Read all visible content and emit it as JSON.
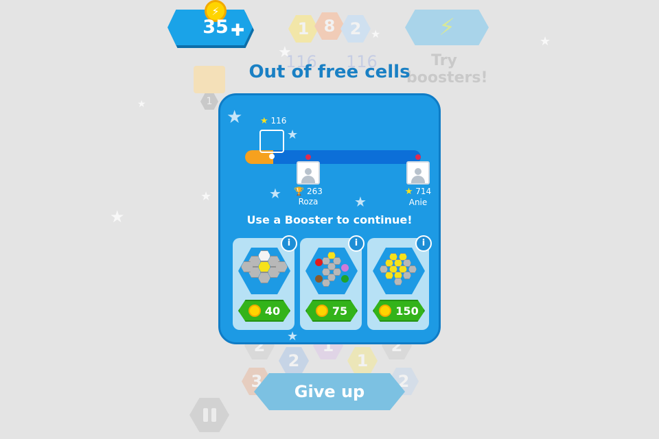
{
  "header": {
    "coin_balance": "35",
    "add_coins_icon": "plus-icon"
  },
  "background": {
    "top_hexes": [
      "1",
      "8",
      "2"
    ],
    "scores_left": "116",
    "scores_right": "116",
    "gift_badge": "1",
    "try_boosters": "Try\nboosters!",
    "board_numbers": [
      "2",
      "2",
      "1",
      "1",
      "2",
      "3",
      "2"
    ]
  },
  "dialog": {
    "title": "Out of free cells",
    "you_score": "116",
    "progress_fraction": 0.16,
    "rivals": [
      {
        "name": "Roza",
        "score": "263",
        "icon": "trophy-icon"
      },
      {
        "name": "Anie",
        "score": "714",
        "icon": "star-icon"
      }
    ],
    "subtitle": "Use a Booster to continue!",
    "boosters": [
      {
        "id": "hammer",
        "price": "40",
        "info": "i"
      },
      {
        "id": "colors",
        "price": "75",
        "info": "i"
      },
      {
        "id": "bomb",
        "price": "150",
        "info": "i"
      }
    ]
  },
  "footer": {
    "give_up_label": "Give up"
  },
  "colors": {
    "panel": "#1d9ae4",
    "progress_bar": "#0c6fd8",
    "progress_fill": "#f6a11e",
    "price_button": "#33b31a",
    "title": "#1a80c4"
  }
}
